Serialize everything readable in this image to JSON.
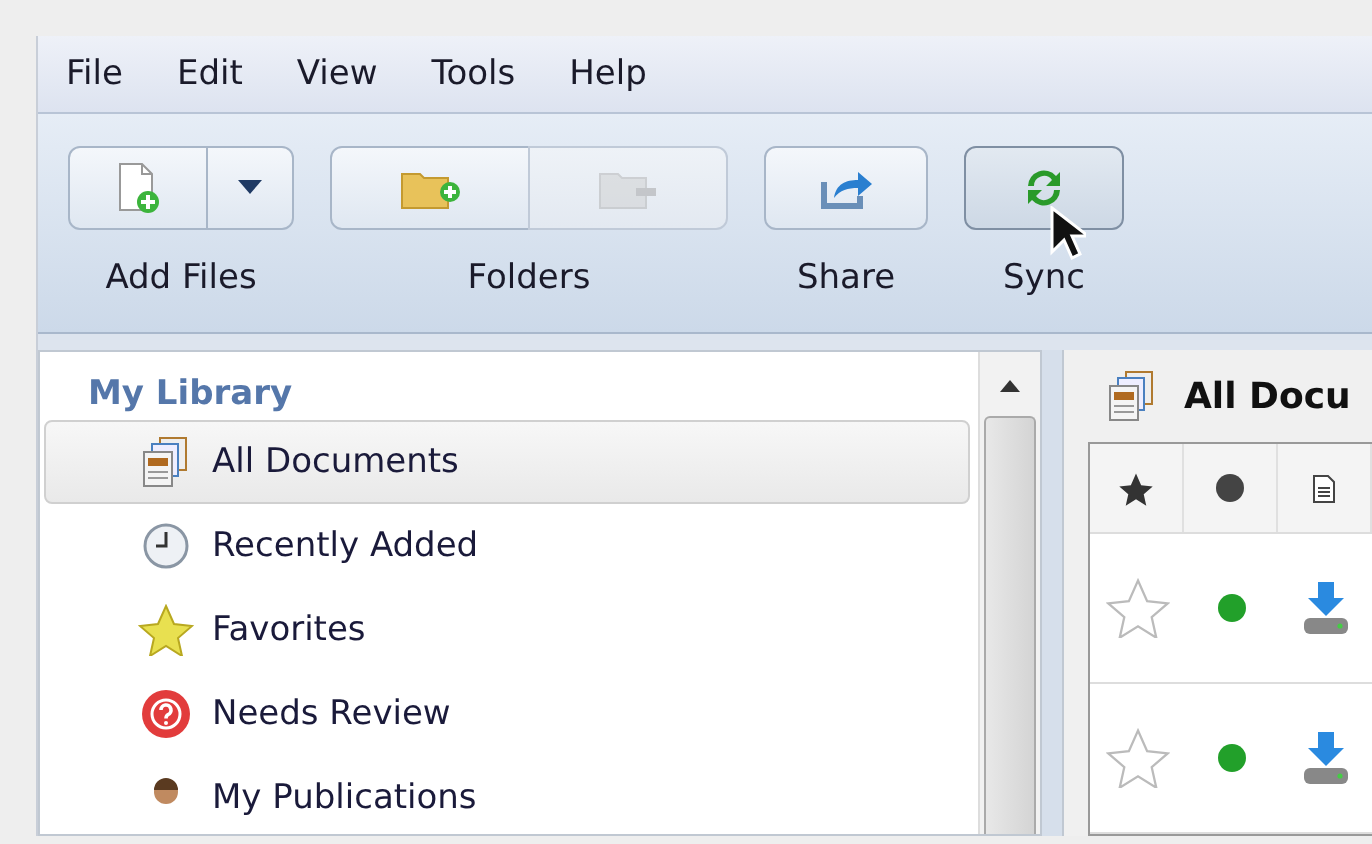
{
  "menu": [
    "File",
    "Edit",
    "View",
    "Tools",
    "Help"
  ],
  "toolbar": [
    {
      "label": "Add Files",
      "buttons": [
        {
          "kind": "add-file",
          "disabled": false
        },
        {
          "kind": "dropdown",
          "disabled": false
        }
      ]
    },
    {
      "label": "Folders",
      "buttons": [
        {
          "kind": "add-folder",
          "disabled": false
        },
        {
          "kind": "remove-folder",
          "disabled": true
        }
      ]
    },
    {
      "label": "Share",
      "buttons": [
        {
          "kind": "share",
          "disabled": false
        }
      ]
    },
    {
      "label": "Sync",
      "buttons": [
        {
          "kind": "sync",
          "disabled": false
        }
      ]
    }
  ],
  "sidebar": {
    "title": "My Library",
    "items": [
      {
        "label": "All Documents",
        "kind": "documents",
        "selected": true
      },
      {
        "label": "Recently Added",
        "kind": "clock",
        "selected": false
      },
      {
        "label": "Favorites",
        "kind": "star",
        "selected": false
      },
      {
        "label": "Needs Review",
        "kind": "question",
        "selected": false
      },
      {
        "label": "My Publications",
        "kind": "person",
        "selected": false
      }
    ]
  },
  "content": {
    "title": "All Docu",
    "rows": [
      {
        "starred": false,
        "color": "#22a02a"
      },
      {
        "starred": false,
        "color": "#22a02a"
      }
    ]
  }
}
